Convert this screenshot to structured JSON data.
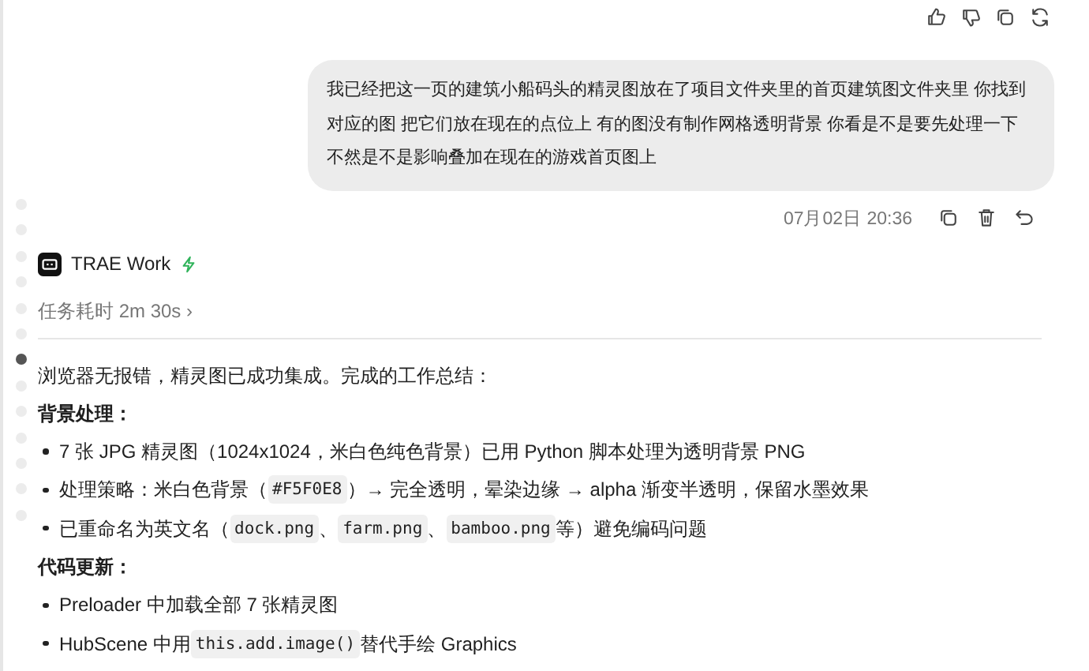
{
  "message_actions": [
    {
      "kind": "thumbs-up"
    },
    {
      "kind": "thumbs-down"
    },
    {
      "kind": "copy"
    },
    {
      "kind": "refresh"
    }
  ],
  "user_message": {
    "text": "我已经把这一页的建筑小船码头的精灵图放在了项目文件夹里的首页建筑图文件夹里 你找到对应的图 把它们放在现在的点位上 有的图没有制作网格透明背景 你看是不是要先处理一下不然是不是影响叠加在现在的游戏首页图上",
    "timestamp": "07月02日 20:36",
    "actions": [
      {
        "kind": "copy"
      },
      {
        "kind": "delete"
      },
      {
        "kind": "undo"
      }
    ]
  },
  "timeline_dots": [
    {
      "selected": false
    },
    {
      "selected": false
    },
    {
      "selected": false
    },
    {
      "selected": false
    },
    {
      "selected": false
    },
    {
      "selected": false
    },
    {
      "selected": true
    },
    {
      "selected": false
    },
    {
      "selected": false
    },
    {
      "selected": false
    },
    {
      "selected": false
    },
    {
      "selected": false
    },
    {
      "selected": false
    }
  ],
  "agent": {
    "name": "TRAE Work",
    "task_time": "任务耗时 2m 30s",
    "expand_glyph": "›"
  },
  "response": [
    {
      "kind": "paragraph",
      "parts": [
        {
          "kind": "text",
          "text": "浏览器无报错，精灵图已成功集成。完成的工作总结："
        }
      ]
    },
    {
      "kind": "heading",
      "parts": [
        {
          "kind": "text",
          "text": "背景处理："
        }
      ]
    },
    {
      "kind": "bullet",
      "parts": [
        {
          "kind": "text",
          "text": "7 张 JPG 精灵图（1024x1024，米白色纯色背景）已用 Python 脚本处理为透明背景 PNG"
        }
      ]
    },
    {
      "kind": "bullet",
      "parts": [
        {
          "kind": "text",
          "text": "处理策略：米白色背景（"
        },
        {
          "kind": "code",
          "text": "#F5F0E8"
        },
        {
          "kind": "text",
          "text": "）→ 完全透明，晕染边缘 → alpha 渐变半透明，保留水墨效果"
        }
      ]
    },
    {
      "kind": "bullet",
      "parts": [
        {
          "kind": "text",
          "text": "已重命名为英文名（"
        },
        {
          "kind": "code",
          "text": "dock.png"
        },
        {
          "kind": "text",
          "text": "、"
        },
        {
          "kind": "code",
          "text": "farm.png"
        },
        {
          "kind": "text",
          "text": "、"
        },
        {
          "kind": "code",
          "text": "bamboo.png"
        },
        {
          "kind": "text",
          "text": " 等）避免编码问题"
        }
      ]
    },
    {
      "kind": "heading",
      "parts": [
        {
          "kind": "text",
          "text": "代码更新："
        }
      ]
    },
    {
      "kind": "bullet",
      "parts": [
        {
          "kind": "text",
          "text": "Preloader 中加载全部 7 张精灵图"
        }
      ]
    },
    {
      "kind": "bullet",
      "parts": [
        {
          "kind": "text",
          "text": "HubScene 中用 "
        },
        {
          "kind": "code",
          "text": "this.add.image()"
        },
        {
          "kind": "text",
          "text": " 替代手绘 Graphics"
        }
      ]
    }
  ]
}
